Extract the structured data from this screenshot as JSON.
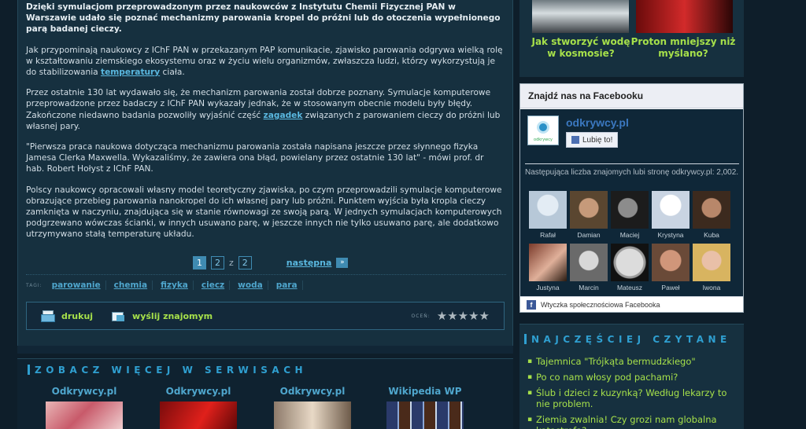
{
  "article": {
    "lead": "Dzięki symulacjom przeprowadzonym przez naukowców z Instytutu Chemii Fizycznej PAN w Warszawie udało się poznać mechanizmy parowania kropel do próżni lub do otoczenia wypełnionego parą badanej cieczy.",
    "p1_before": "Jak przypominają naukowcy z IChF PAN w przekazanym PAP komunikacie, zjawisko parowania odgrywa wielką rolę w kształtowaniu ziemskiego ekosystemu oraz w życiu wielu organizmów, zwłaszcza ludzi, którzy wykorzystują je do stabilizowania ",
    "p1_link": "temperatury",
    "p1_after": " ciała.",
    "p2_before": "Przez ostatnie 130 lat wydawało się, że mechanizm parowania został dobrze poznany. Symulacje komputerowe przeprowadzone przez badaczy z IChF PAN wykazały jednak, że w stosowanym obecnie modelu były błędy. Zakończone niedawno badania pozwoliły wyjaśnić część ",
    "p2_link": "zagadek",
    "p2_after": " związanych z parowaniem cieczy do próżni lub własnej pary.",
    "p3": "\"Pierwsza praca naukowa dotycząca mechanizmu parowania została napisana jeszcze przez słynnego fizyka Jamesa Clerka Maxwella. Wykazaliśmy, że zawiera ona błąd, powielany przez ostatnie 130 lat\" - mówi prof. dr hab. Robert Hołyst z IChF PAN.",
    "p4": "Polscy naukowcy opracowali własny model teoretyczny zjawiska, po czym przeprowadzili symulacje komputerowe obrazujące przebieg parowania nanokropel do ich własnej pary lub próżni. Punktem wyjścia była kropla cieczy zamknięta w naczyniu, znajdująca się w stanie równowagi ze swoją parą. W jednych symulacjach komputerowych podgrzewano wówczas ścianki, w innych usuwano parę, w jeszcze innych nie tylko usuwano parę, ale dodatkowo utrzymywano stałą temperaturę układu."
  },
  "pager": {
    "page1": "1",
    "page2": "2",
    "sep": "z",
    "total": "2",
    "next": "następna",
    "next_icon": "»"
  },
  "tags": {
    "label": "TAGI:",
    "items": [
      "parowanie",
      "chemia",
      "fizyka",
      "ciecz",
      "woda",
      "para"
    ]
  },
  "toolbar": {
    "print": "drukuj",
    "send": "wyślij znajomym",
    "rate_label": "OCEŃ:",
    "stars": "★★★★★",
    "rating": 0,
    "rating_max": 5
  },
  "more": {
    "title": "ZOBACZ WIĘCEJ W SERWISACH",
    "items": [
      "Odkrywcy.pl",
      "Odkrywcy.pl",
      "Odkrywcy.pl",
      "Wikipedia WP"
    ]
  },
  "thumbs": [
    {
      "caption": "Jak stworzyć wodę w kosmosie?"
    },
    {
      "caption": "Proton mniejszy niż myślano?"
    }
  ],
  "facebook": {
    "header": "Znajdź nas na Facebooku",
    "page_name": "odkrywcy.pl",
    "logo_text": "odkrywcy",
    "like": "Lubię to!",
    "count_text": "Następująca liczba znajomych lubi stronę odkrywcy.pl: 2,002.",
    "fans": [
      "Rafał",
      "Damian",
      "Maciej",
      "Krystyna",
      "Kuba",
      "Justyna",
      "Marcin",
      "Mateusz",
      "Paweł",
      "Iwona"
    ],
    "footer": "Wtyczka społecznościowa Facebooka",
    "footer_icon": "f"
  },
  "popular": {
    "title": "NAJCZĘŚCIEJ CZYTANE",
    "items": [
      "Tajemnica \"Trójkąta bermudzkiego\"",
      "Po co nam włosy pod pachami?",
      "Ślub i dzieci z kuzynką? Według lekarzy to nie problem.",
      "Ziemia zwalnia! Czy grozi nam globalna katastrofa?"
    ]
  },
  "colors": {
    "background": "#0e1e2a",
    "panel": "#16303f",
    "link": "#5ab8e0",
    "accent_green": "#a6e04a",
    "section_title": "#2f9fd0",
    "facebook_blue": "#3b5998"
  }
}
